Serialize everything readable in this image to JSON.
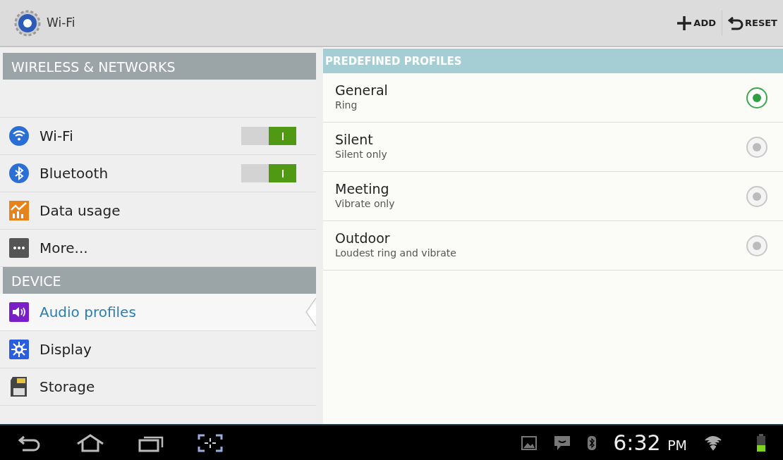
{
  "action_bar": {
    "title": "Wi-Fi",
    "actions": [
      {
        "kind": "add",
        "label": "ADD"
      },
      {
        "kind": "reset",
        "label": "RESET"
      }
    ]
  },
  "sidebar": {
    "sections": [
      {
        "header": "WIRELESS & NETWORKS",
        "items": [
          {
            "label": "Wi-Fi",
            "on": true,
            "selected": false
          },
          {
            "label": "Bluetooth",
            "on": true,
            "selected": false
          },
          {
            "label": "Data usage",
            "selected": false
          },
          {
            "label": "More...",
            "selected": false
          }
        ]
      },
      {
        "header": "DEVICE",
        "items": [
          {
            "label": "Audio profiles",
            "selected": true
          },
          {
            "label": "Display",
            "selected": false
          },
          {
            "label": "Storage",
            "selected": false
          }
        ]
      }
    ]
  },
  "profiles": {
    "header": "PREDEFINED PROFILES",
    "items": [
      {
        "name": "General",
        "summary": "Ring",
        "selected": true
      },
      {
        "name": "Silent",
        "summary": "Silent only",
        "selected": false
      },
      {
        "name": "Meeting",
        "summary": "Vibrate only",
        "selected": false
      },
      {
        "name": "Outdoor",
        "summary": "Loudest ring and vibrate",
        "selected": false
      }
    ]
  },
  "status_bar": {
    "time": "6:32",
    "period": "PM"
  }
}
